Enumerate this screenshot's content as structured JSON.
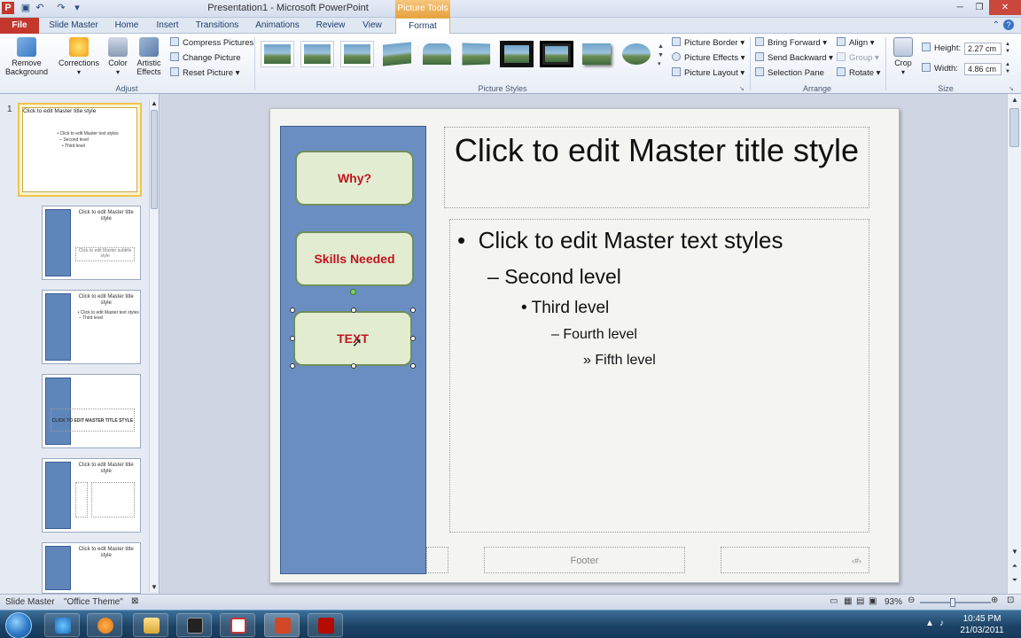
{
  "window": {
    "title": "Presentation1 - Microsoft PowerPoint",
    "context_tab": "Picture Tools"
  },
  "tabs": [
    "File",
    "Slide Master",
    "Home",
    "Insert",
    "Transitions",
    "Animations",
    "Review",
    "View",
    "Format"
  ],
  "ribbon": {
    "adjust": {
      "label": "Adjust",
      "remove_background": "Remove Background",
      "corrections": "Corrections",
      "color": "Color",
      "artistic_effects": "Artistic Effects",
      "compress": "Compress Pictures",
      "change": "Change Picture",
      "reset": "Reset Picture"
    },
    "picture_styles": {
      "label": "Picture Styles",
      "border": "Picture Border",
      "effects": "Picture Effects",
      "layout": "Picture Layout"
    },
    "arrange": {
      "label": "Arrange",
      "bring_forward": "Bring Forward",
      "send_backward": "Send Backward",
      "selection_pane": "Selection Pane",
      "align": "Align",
      "group": "Group",
      "rotate": "Rotate"
    },
    "size": {
      "label": "Size",
      "crop": "Crop",
      "height_label": "Height:",
      "height_value": "2.27 cm",
      "width_label": "Width:",
      "width_value": "4.86 cm"
    }
  },
  "thumbnails": {
    "first_number": "1",
    "title_text": "Click to edit Master title style",
    "text_line": "Click to edit Master text styles",
    "second": "Second level",
    "third": "Third level",
    "fourth": "Fourth level",
    "caps_title": "CLICK TO EDIT MASTER TITLE STYLE",
    "subtitle": "Click to edit Master subtitle style"
  },
  "slide": {
    "nav": [
      "Why?",
      "Skills Needed",
      "TEXT"
    ],
    "title": "Click to edit Master title style",
    "levels": [
      "Click to edit Master text styles",
      "Second level",
      "Third level",
      "Fourth level",
      "Fifth level"
    ],
    "bullets": [
      "•",
      "–",
      "•",
      "–",
      "»"
    ],
    "footer": "Footer",
    "page_number": "‹#›"
  },
  "status": {
    "view": "Slide Master",
    "theme": "\"Office Theme\"",
    "zoom": "93%"
  },
  "taskbar": {
    "time": "10:45 PM",
    "date": "21/03/2011"
  },
  "colors": {
    "file_tab": "#c3372d",
    "sidebar": "#6a8ec2",
    "nav_box_fill": "#e2ecd1",
    "nav_text": "#c0141f",
    "selection_thumb": "#f2c14d"
  }
}
